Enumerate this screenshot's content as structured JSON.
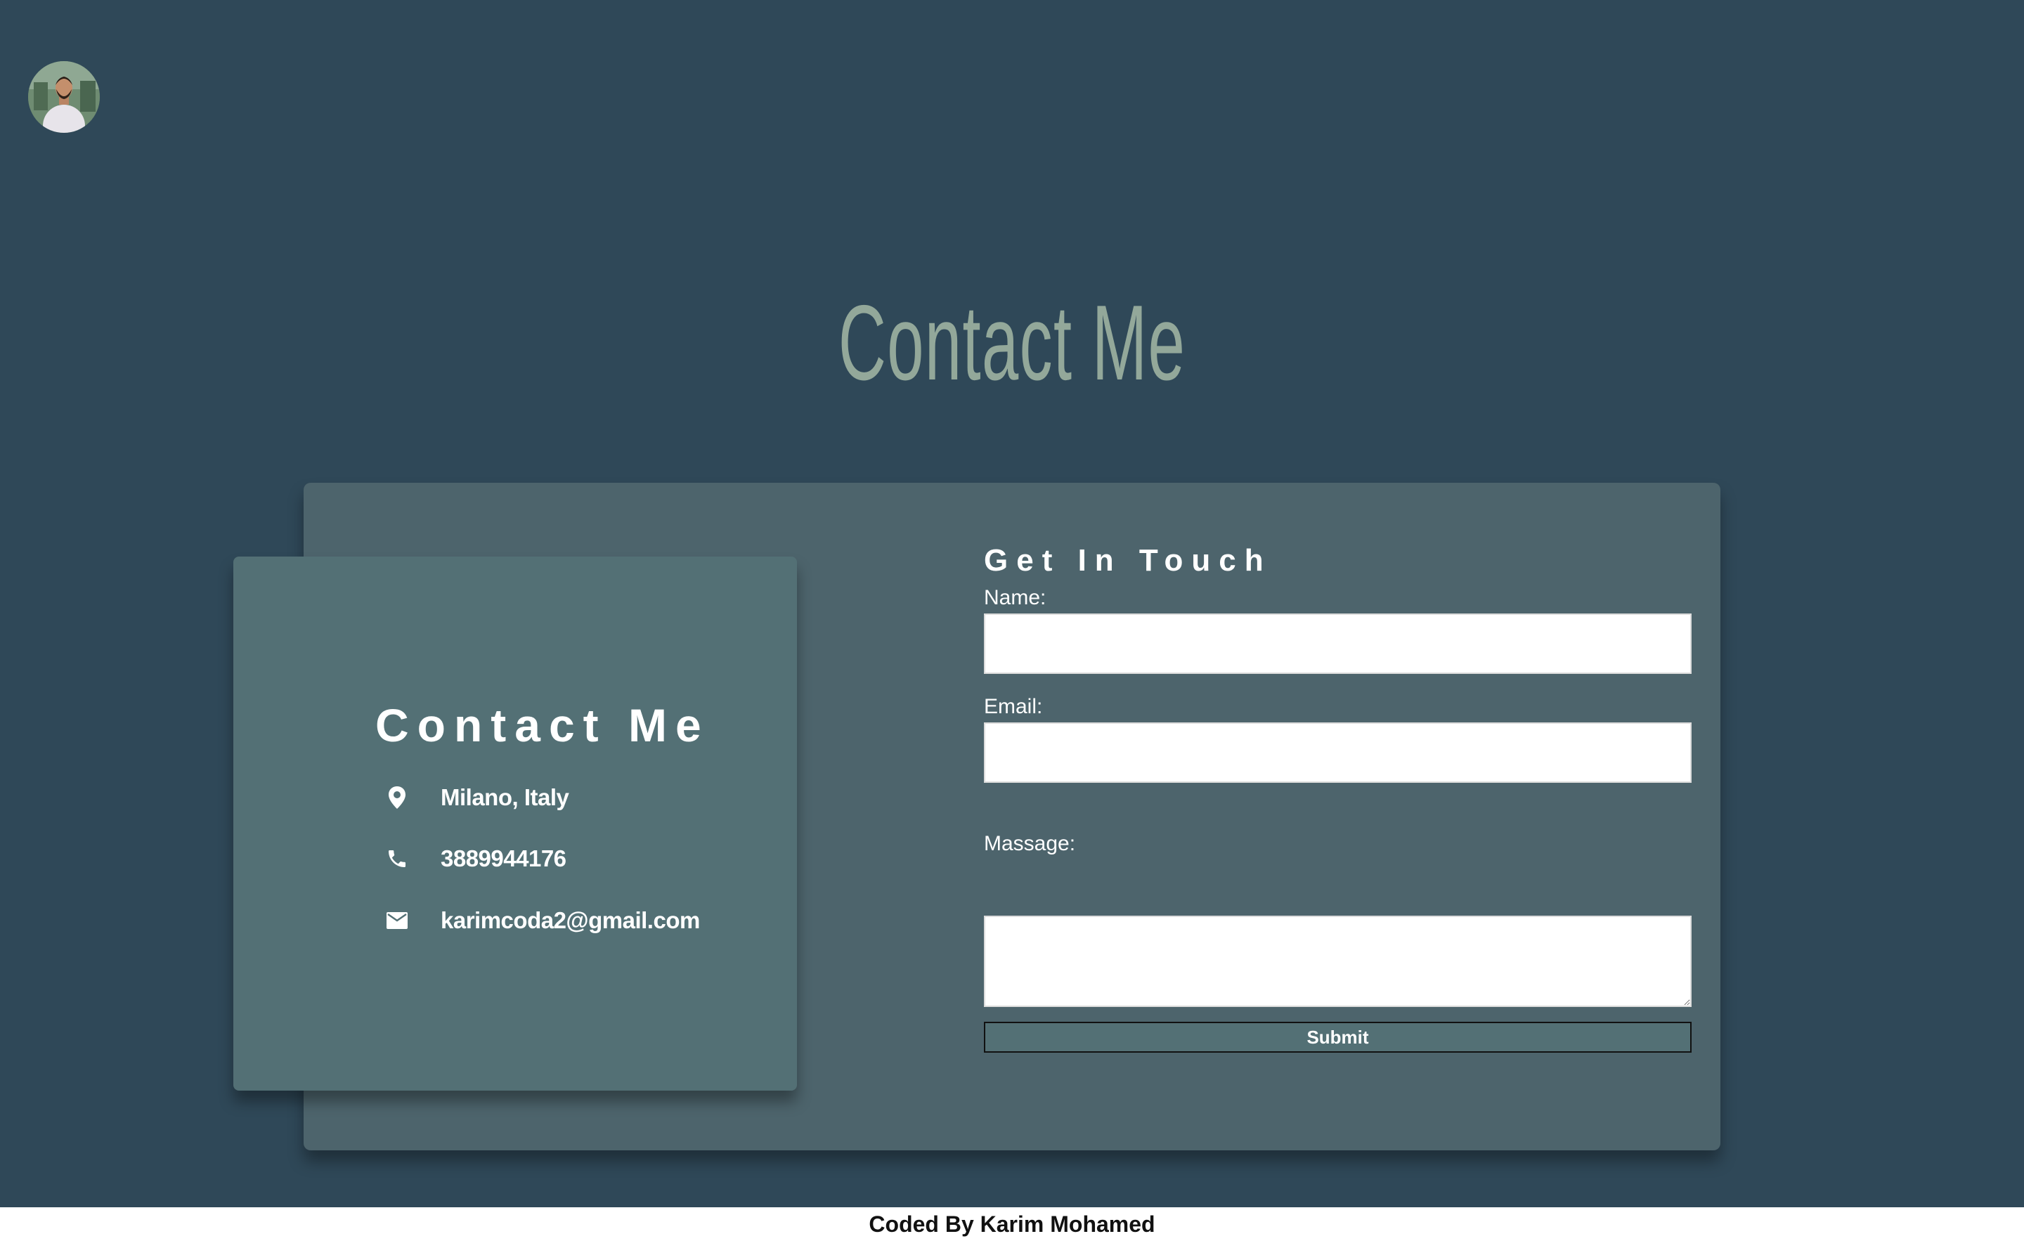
{
  "header": {
    "avatar_alt": "profile photo"
  },
  "page": {
    "title": "Contact Me"
  },
  "info": {
    "title": "Contact Me",
    "items": [
      {
        "icon": "location-pin-icon",
        "text": "Milano, Italy"
      },
      {
        "icon": "phone-icon",
        "text": "3889944176"
      },
      {
        "icon": "mail-icon",
        "text": "karimcoda2@gmail.com"
      }
    ]
  },
  "form": {
    "title": "Get In Touch",
    "name_label": "Name:",
    "name_value": "",
    "email_label": "Email:",
    "email_value": "",
    "message_label": "Massage:",
    "message_value": "",
    "submit_label": "Submit"
  },
  "footer": {
    "text": "Coded By Karim Mohamed"
  },
  "colors": {
    "background": "#2f4858",
    "outer_card": "#4d646c",
    "info_card": "#537075",
    "title_text": "#93a89a",
    "footer_bg": "#ffffff"
  }
}
